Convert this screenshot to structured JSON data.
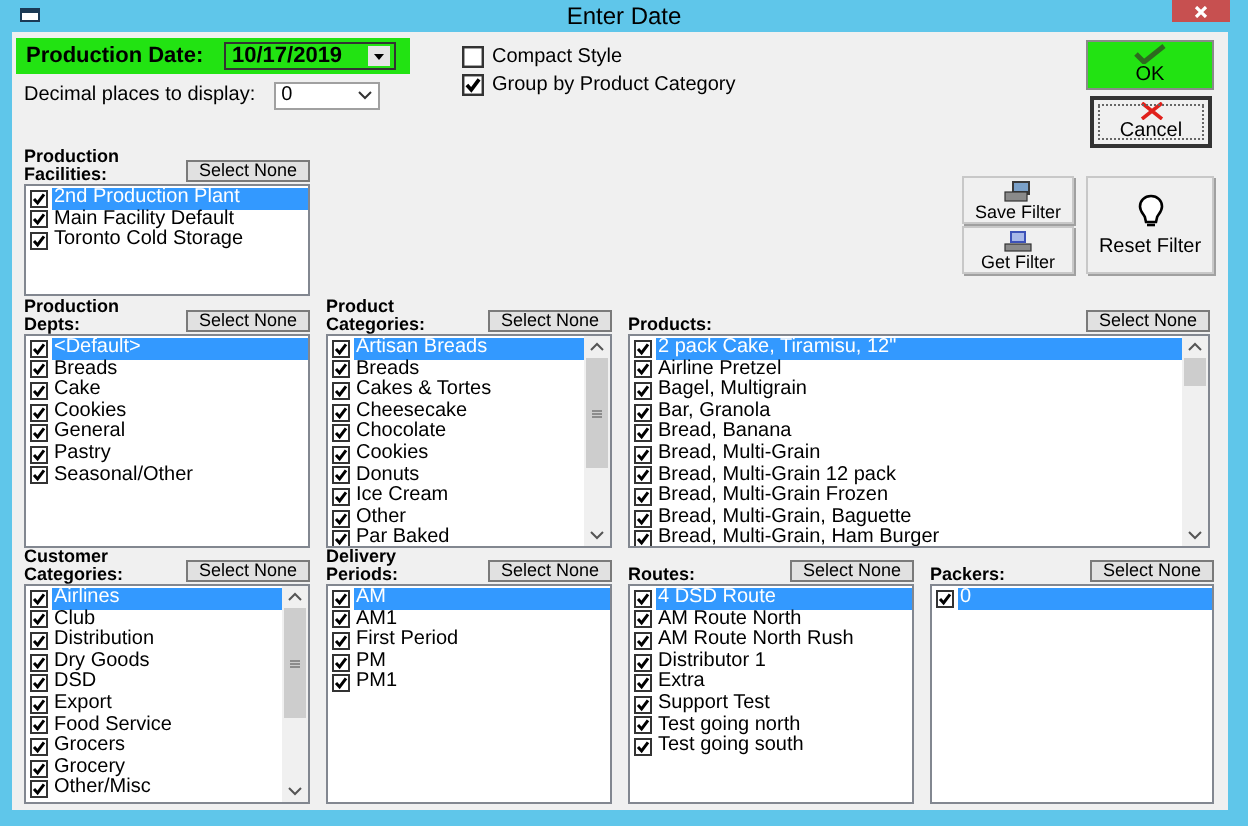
{
  "window": {
    "title": "Enter Date"
  },
  "production_date": {
    "label": "Production Date:",
    "value": "10/17/2019"
  },
  "decimal_places": {
    "label": "Decimal places to display:",
    "value": "0"
  },
  "options": [
    {
      "label": "Compact Style",
      "checked": false
    },
    {
      "label": "Group by Product Category",
      "checked": true
    }
  ],
  "buttons": {
    "ok": "OK",
    "cancel": "Cancel",
    "save_filter": "Save Filter",
    "get_filter": "Get Filter",
    "reset_filter": "Reset Filter"
  },
  "lists": [
    {
      "label": "Production Facilities:",
      "button": "Select None",
      "items": [
        {
          "label": "2nd Production Plant",
          "checked": true,
          "selected": true
        },
        {
          "label": "Main Facility Default",
          "checked": true,
          "selected": false
        },
        {
          "label": "Toronto Cold Storage",
          "checked": true,
          "selected": false
        }
      ]
    },
    {
      "label": "Production Depts:",
      "button": "Select None",
      "items": [
        {
          "label": "<Default>",
          "checked": true,
          "selected": true
        },
        {
          "label": "Breads",
          "checked": true,
          "selected": false
        },
        {
          "label": "Cake",
          "checked": true,
          "selected": false
        },
        {
          "label": "Cookies",
          "checked": true,
          "selected": false
        },
        {
          "label": "General",
          "checked": true,
          "selected": false
        },
        {
          "label": "Pastry",
          "checked": true,
          "selected": false
        },
        {
          "label": "Seasonal/Other",
          "checked": true,
          "selected": false
        }
      ]
    },
    {
      "label": "Product Categories:",
      "button": "Select None",
      "items": [
        {
          "label": "Artisan Breads",
          "checked": true,
          "selected": true
        },
        {
          "label": "Breads",
          "checked": true,
          "selected": false
        },
        {
          "label": "Cakes & Tortes",
          "checked": true,
          "selected": false
        },
        {
          "label": "Cheesecake",
          "checked": true,
          "selected": false
        },
        {
          "label": "Chocolate",
          "checked": true,
          "selected": false
        },
        {
          "label": "Cookies",
          "checked": true,
          "selected": false
        },
        {
          "label": "Donuts",
          "checked": true,
          "selected": false
        },
        {
          "label": "Ice Cream",
          "checked": true,
          "selected": false
        },
        {
          "label": "Other",
          "checked": true,
          "selected": false
        },
        {
          "label": "Par Baked",
          "checked": true,
          "selected": false
        }
      ]
    },
    {
      "label": "Products:",
      "button": "Select None",
      "items": [
        {
          "label": "2 pack Cake, Tiramisu, 12\"",
          "checked": true,
          "selected": true
        },
        {
          "label": "Airline Pretzel",
          "checked": true,
          "selected": false
        },
        {
          "label": "Bagel, Multigrain",
          "checked": true,
          "selected": false
        },
        {
          "label": "Bar, Granola",
          "checked": true,
          "selected": false
        },
        {
          "label": "Bread, Banana",
          "checked": true,
          "selected": false
        },
        {
          "label": "Bread, Multi-Grain",
          "checked": true,
          "selected": false
        },
        {
          "label": "Bread, Multi-Grain 12 pack",
          "checked": true,
          "selected": false
        },
        {
          "label": "Bread, Multi-Grain Frozen",
          "checked": true,
          "selected": false
        },
        {
          "label": "Bread, Multi-Grain, Baguette",
          "checked": true,
          "selected": false
        },
        {
          "label": "Bread, Multi-Grain, Ham Burger",
          "checked": true,
          "selected": false
        }
      ]
    },
    {
      "label": "Customer Categories:",
      "button": "Select None",
      "items": [
        {
          "label": "Airlines",
          "checked": true,
          "selected": true
        },
        {
          "label": "Club",
          "checked": true,
          "selected": false
        },
        {
          "label": "Distribution",
          "checked": true,
          "selected": false
        },
        {
          "label": "Dry Goods",
          "checked": true,
          "selected": false
        },
        {
          "label": "DSD",
          "checked": true,
          "selected": false
        },
        {
          "label": "Export",
          "checked": true,
          "selected": false
        },
        {
          "label": "Food Service",
          "checked": true,
          "selected": false
        },
        {
          "label": "Grocers",
          "checked": true,
          "selected": false
        },
        {
          "label": "Grocery",
          "checked": true,
          "selected": false
        },
        {
          "label": "Other/Misc",
          "checked": true,
          "selected": false
        }
      ]
    },
    {
      "label": "Delivery Periods:",
      "button": "Select None",
      "items": [
        {
          "label": "AM",
          "checked": true,
          "selected": true
        },
        {
          "label": "AM1",
          "checked": true,
          "selected": false
        },
        {
          "label": "First Period",
          "checked": true,
          "selected": false
        },
        {
          "label": "PM",
          "checked": true,
          "selected": false
        },
        {
          "label": "PM1",
          "checked": true,
          "selected": false
        }
      ]
    },
    {
      "label": "Routes:",
      "button": "Select None",
      "items": [
        {
          "label": "4 DSD Route",
          "checked": true,
          "selected": true
        },
        {
          "label": "AM Route North",
          "checked": true,
          "selected": false
        },
        {
          "label": "AM Route North Rush",
          "checked": true,
          "selected": false
        },
        {
          "label": "Distributor 1",
          "checked": true,
          "selected": false
        },
        {
          "label": "Extra",
          "checked": true,
          "selected": false
        },
        {
          "label": "Support Test",
          "checked": true,
          "selected": false
        },
        {
          "label": "Test going north",
          "checked": true,
          "selected": false
        },
        {
          "label": "Test going south",
          "checked": true,
          "selected": false
        }
      ]
    },
    {
      "label": "Packers:",
      "button": "Select None",
      "items": [
        {
          "label": "0",
          "checked": true,
          "selected": true
        }
      ]
    }
  ]
}
